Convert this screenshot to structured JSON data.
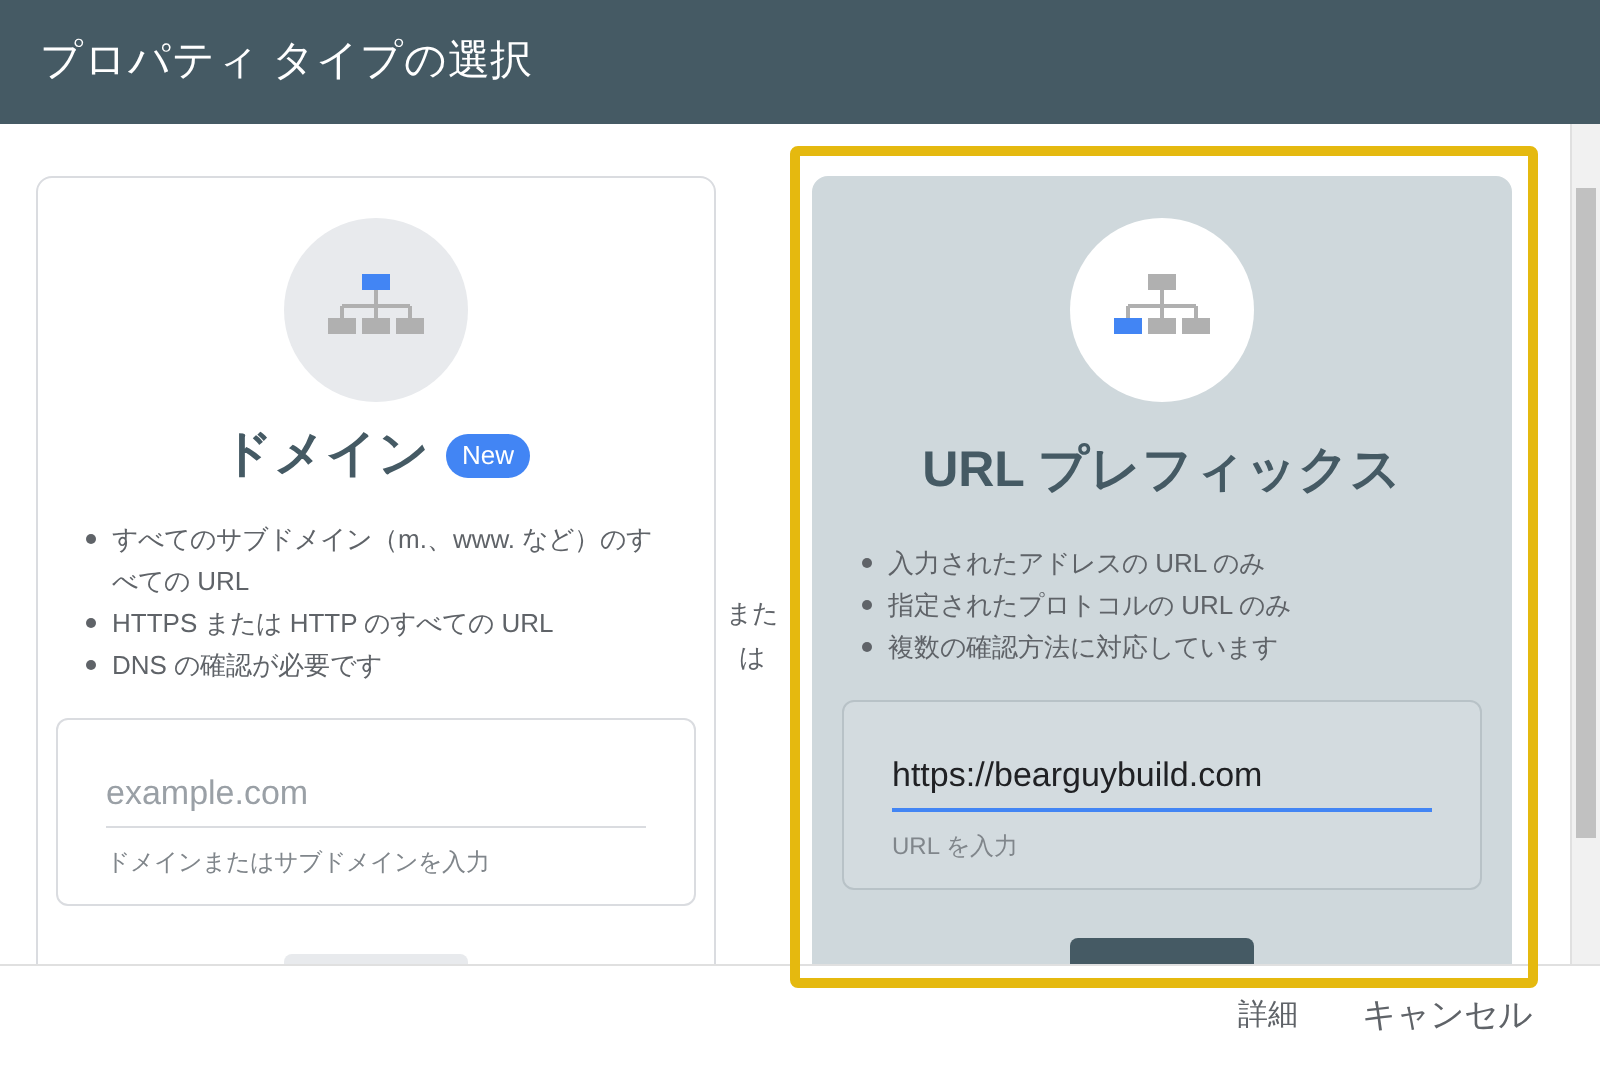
{
  "window": {
    "title": "プロパティ タイプの選択"
  },
  "options": [
    {
      "kind": "domain",
      "title": "ドメイン",
      "badge": "New",
      "selected": false,
      "bullets": [
        "すべてのサブドメイン（m.、www. など）のすべての URL",
        "HTTPS または HTTP のすべての URL",
        "DNS の確認が必要です"
      ],
      "field": {
        "placeholder": "example.com",
        "helper": "ドメインまたはサブドメインを入力"
      }
    },
    {
      "kind": "url_prefix",
      "title": "URL プレフィックス",
      "selected": true,
      "bullets": [
        "入力されたアドレスの URL のみ",
        "指定されたプロトコルの URL のみ",
        "複数の確認方法に対応しています"
      ],
      "field": {
        "value": "https://bearguybuild.com",
        "helper": "URL を入力"
      }
    }
  ],
  "separator": "または",
  "footer": {
    "buttons": [
      "詳細",
      "キャンセル"
    ]
  }
}
